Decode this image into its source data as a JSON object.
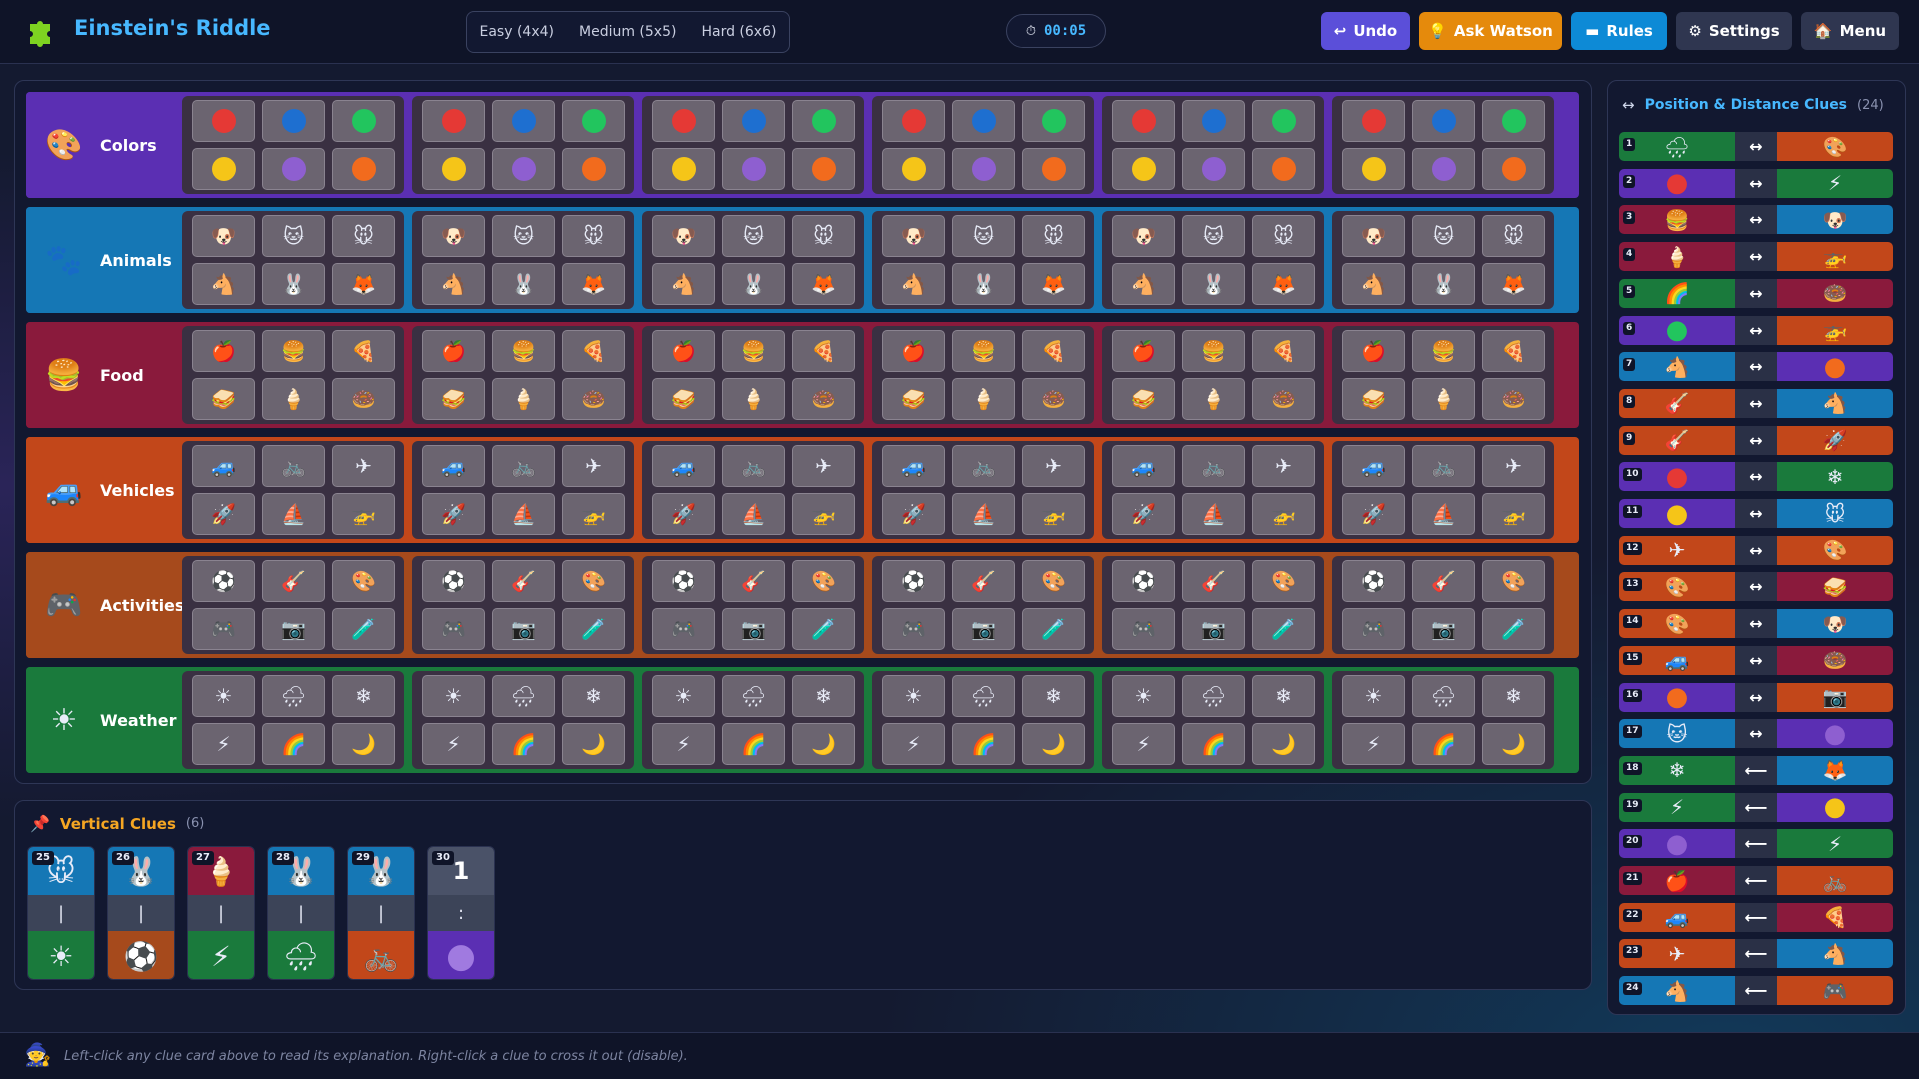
{
  "app": {
    "title": "Einstein's Riddle"
  },
  "difficulty": [
    "Easy (4x4)",
    "Medium (5x5)",
    "Hard (6x6)"
  ],
  "timer": {
    "icon": "⏱",
    "value": "00:05"
  },
  "buttons": {
    "undo": {
      "icon": "↩",
      "label": "Undo",
      "color": "#5b4fd9"
    },
    "watson": {
      "icon": "💡",
      "label": "Ask Watson",
      "color": "#e58a0c"
    },
    "rules": {
      "icon": "▬",
      "label": "Rules",
      "color": "#0d8ad6"
    },
    "settings": {
      "icon": "⚙",
      "label": "Settings",
      "color": "#2f3650"
    },
    "menu": {
      "icon": "🏠",
      "label": "Menu",
      "color": "#2f3650"
    }
  },
  "categories": [
    {
      "name": "Colors",
      "icon": "🎨",
      "color": "#5b2fb3",
      "items": [
        {
          "type": "dot",
          "v": "#e53935"
        },
        {
          "type": "dot",
          "v": "#1e6fd0"
        },
        {
          "type": "dot",
          "v": "#22c55e"
        },
        {
          "type": "dot",
          "v": "#f5c518"
        },
        {
          "type": "dot",
          "v": "#8e5fd0"
        },
        {
          "type": "dot",
          "v": "#f26b1d"
        }
      ]
    },
    {
      "name": "Animals",
      "icon": "🐾",
      "color": "#1577b5",
      "items": [
        {
          "type": "emoji",
          "v": "🐶"
        },
        {
          "type": "emoji",
          "v": "🐱"
        },
        {
          "type": "emoji",
          "v": "🐭"
        },
        {
          "type": "emoji",
          "v": "🐴"
        },
        {
          "type": "emoji",
          "v": "🐰"
        },
        {
          "type": "emoji",
          "v": "🦊"
        }
      ]
    },
    {
      "name": "Food",
      "icon": "🍔",
      "color": "#8a1a3c",
      "items": [
        {
          "type": "emoji",
          "v": "🍎"
        },
        {
          "type": "emoji",
          "v": "🍔"
        },
        {
          "type": "emoji",
          "v": "🍕"
        },
        {
          "type": "emoji",
          "v": "🥪"
        },
        {
          "type": "emoji",
          "v": "🍦"
        },
        {
          "type": "emoji",
          "v": "🍩"
        }
      ]
    },
    {
      "name": "Vehicles",
      "icon": "🚙",
      "color": "#c2471a",
      "items": [
        {
          "type": "emoji",
          "v": "🚙"
        },
        {
          "type": "emoji",
          "v": "🚲"
        },
        {
          "type": "emoji",
          "v": "✈"
        },
        {
          "type": "emoji",
          "v": "🚀"
        },
        {
          "type": "emoji",
          "v": "⛵"
        },
        {
          "type": "emoji",
          "v": "🚁"
        }
      ]
    },
    {
      "name": "Activities",
      "icon": "🎮",
      "color": "#a64a1c",
      "items": [
        {
          "type": "emoji",
          "v": "⚽"
        },
        {
          "type": "emoji",
          "v": "🎸"
        },
        {
          "type": "emoji",
          "v": "🎨"
        },
        {
          "type": "emoji",
          "v": "🎮"
        },
        {
          "type": "emoji",
          "v": "📷"
        },
        {
          "type": "emoji",
          "v": "🧪"
        }
      ]
    },
    {
      "name": "Weather",
      "icon": "☀",
      "color": "#1a7a3c",
      "items": [
        {
          "type": "emoji",
          "v": "☀"
        },
        {
          "type": "emoji",
          "v": "🌧"
        },
        {
          "type": "emoji",
          "v": "❄"
        },
        {
          "type": "emoji",
          "v": "⚡"
        },
        {
          "type": "emoji",
          "v": "🌈"
        },
        {
          "type": "emoji",
          "v": "🌙"
        }
      ]
    }
  ],
  "vertical_clues": {
    "title": "Vertical Clues",
    "count": "(6)",
    "items": [
      {
        "num": "25",
        "top": "🐭",
        "top_bg": "#1577b5",
        "mid": "|",
        "bottom": "☀",
        "bottom_bg": "#1a7a3c"
      },
      {
        "num": "26",
        "top": "🐰",
        "top_bg": "#1577b5",
        "mid": "|",
        "bottom": "⚽",
        "bottom_bg": "#a64a1c"
      },
      {
        "num": "27",
        "top": "🍦",
        "top_bg": "#8a1a3c",
        "mid": "|",
        "bottom": "⚡",
        "bottom_bg": "#1a7a3c"
      },
      {
        "num": "28",
        "top": "🐰",
        "top_bg": "#1577b5",
        "mid": "|",
        "bottom": "🌧",
        "bottom_bg": "#1a7a3c"
      },
      {
        "num": "29",
        "top": "🐰",
        "top_bg": "#1577b5",
        "mid": "|",
        "bottom": "🚲",
        "bottom_bg": "#c2471a"
      },
      {
        "num": "30",
        "top": "1",
        "top_bg": "#4a5268",
        "mid": ":",
        "bottom": "●",
        "bottom_bg": "#5b2fb3"
      }
    ]
  },
  "position_clues": {
    "title": "Position & Distance Clues",
    "count": "(24)",
    "items": [
      {
        "num": "1",
        "l": "🌧",
        "lbg": "#1a7a3c",
        "a": "↔",
        "r": "🎨",
        "rbg": "#c2471a"
      },
      {
        "num": "2",
        "l": "●",
        "lc": "#e53935",
        "lbg": "#5b2fb3",
        "a": "↔",
        "r": "⚡",
        "rbg": "#1a7a3c"
      },
      {
        "num": "3",
        "l": "🍔",
        "lbg": "#8a1a3c",
        "a": "↔",
        "r": "🐶",
        "rbg": "#1577b5"
      },
      {
        "num": "4",
        "l": "🍦",
        "lbg": "#8a1a3c",
        "a": "↔",
        "r": "🚁",
        "rbg": "#c2471a"
      },
      {
        "num": "5",
        "l": "🌈",
        "lbg": "#1a7a3c",
        "a": "↔",
        "r": "🍩",
        "rbg": "#8a1a3c"
      },
      {
        "num": "6",
        "l": "●",
        "lc": "#22c55e",
        "lbg": "#5b2fb3",
        "a": "↔",
        "r": "🚁",
        "rbg": "#c2471a"
      },
      {
        "num": "7",
        "l": "🐴",
        "lbg": "#1577b5",
        "a": "↔",
        "r": "●",
        "rc": "#f26b1d",
        "rbg": "#5b2fb3"
      },
      {
        "num": "8",
        "l": "🎸",
        "lbg": "#c2471a",
        "a": "↔",
        "r": "🐴",
        "rbg": "#1577b5"
      },
      {
        "num": "9",
        "l": "🎸",
        "lbg": "#c2471a",
        "a": "↔",
        "r": "🚀",
        "rbg": "#c2471a"
      },
      {
        "num": "10",
        "l": "●",
        "lc": "#e53935",
        "lbg": "#5b2fb3",
        "a": "↔",
        "r": "❄",
        "rbg": "#1a7a3c"
      },
      {
        "num": "11",
        "l": "●",
        "lc": "#f5c518",
        "lbg": "#5b2fb3",
        "a": "↔",
        "r": "🐭",
        "rbg": "#1577b5"
      },
      {
        "num": "12",
        "l": "✈",
        "lbg": "#c2471a",
        "a": "↔",
        "r": "🎨",
        "rbg": "#c2471a"
      },
      {
        "num": "13",
        "l": "🎨",
        "lbg": "#c2471a",
        "a": "↔",
        "r": "🥪",
        "rbg": "#8a1a3c"
      },
      {
        "num": "14",
        "l": "🎨",
        "lbg": "#c2471a",
        "a": "↔",
        "r": "🐶",
        "rbg": "#1577b5"
      },
      {
        "num": "15",
        "l": "🚙",
        "lbg": "#c2471a",
        "a": "↔",
        "r": "🍩",
        "rbg": "#8a1a3c"
      },
      {
        "num": "16",
        "l": "●",
        "lc": "#f26b1d",
        "lbg": "#5b2fb3",
        "a": "↔",
        "r": "📷",
        "rbg": "#c2471a"
      },
      {
        "num": "17",
        "l": "🐱",
        "lbg": "#1577b5",
        "a": "↔",
        "r": "●",
        "rc": "#8e5fd0",
        "rbg": "#5b2fb3"
      },
      {
        "num": "18",
        "l": "❄",
        "lbg": "#1a7a3c",
        "a": "⟵",
        "r": "🦊",
        "rbg": "#1577b5"
      },
      {
        "num": "19",
        "l": "⚡",
        "lbg": "#1a7a3c",
        "a": "⟵",
        "r": "●",
        "rc": "#f5c518",
        "rbg": "#5b2fb3"
      },
      {
        "num": "20",
        "l": "●",
        "lc": "#8e5fd0",
        "lbg": "#5b2fb3",
        "a": "⟵",
        "r": "⚡",
        "rbg": "#1a7a3c"
      },
      {
        "num": "21",
        "l": "🍎",
        "lbg": "#8a1a3c",
        "a": "⟵",
        "r": "🚲",
        "rbg": "#c2471a"
      },
      {
        "num": "22",
        "l": "🚙",
        "lbg": "#c2471a",
        "a": "⟵",
        "r": "🍕",
        "rbg": "#8a1a3c"
      },
      {
        "num": "23",
        "l": "✈",
        "lbg": "#c2471a",
        "a": "⟵",
        "r": "🐴",
        "rbg": "#1577b5"
      },
      {
        "num": "24",
        "l": "🐴",
        "lbg": "#1577b5",
        "a": "⟵",
        "r": "🎮",
        "rbg": "#c2471a"
      }
    ]
  },
  "footer": {
    "icon": "🧙",
    "text": "Left-click any clue card above to read its explanation. Right-click a clue to cross it out (disable)."
  }
}
